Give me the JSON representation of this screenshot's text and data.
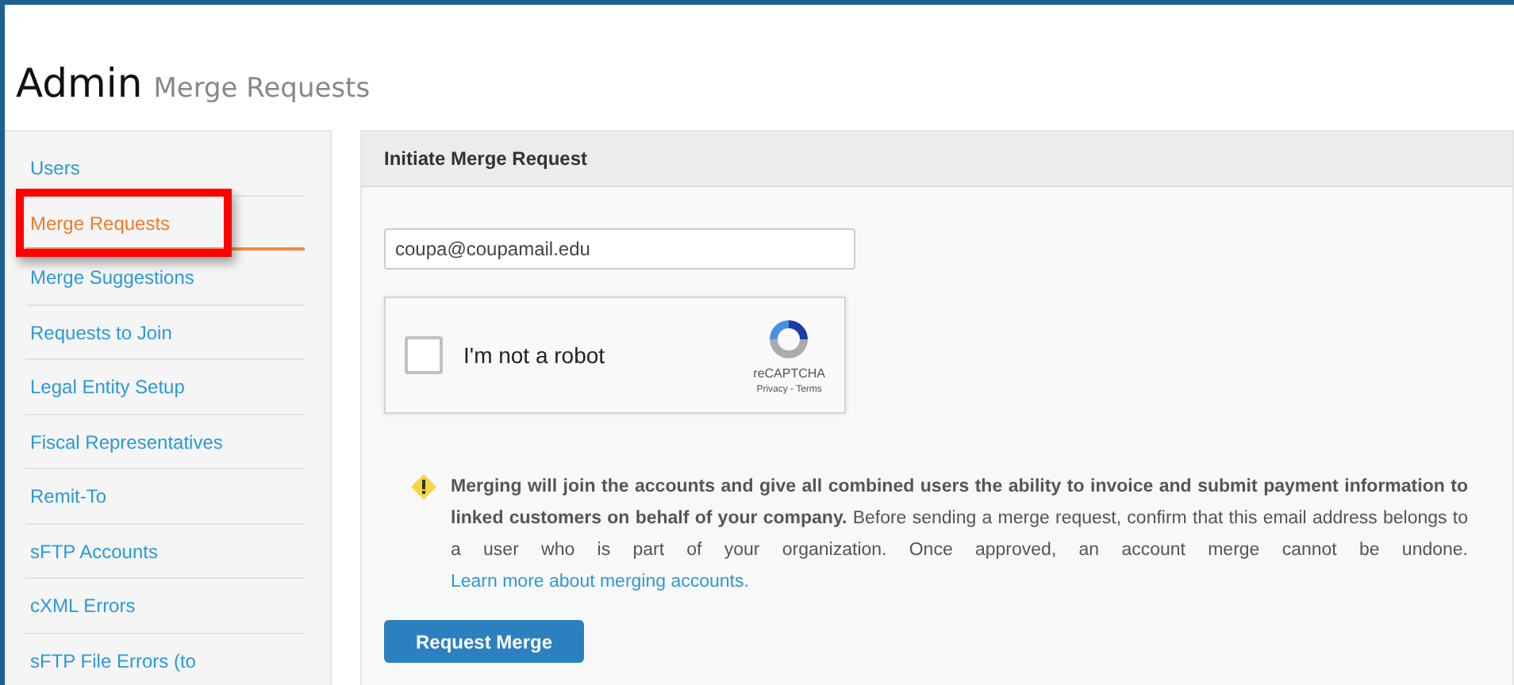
{
  "header": {
    "title": "Admin",
    "subtitle": "Merge Requests"
  },
  "sidebar": {
    "items": [
      {
        "label": "Users",
        "selected": false,
        "highlighted": false
      },
      {
        "label": "Merge Requests",
        "selected": true,
        "highlighted": true
      },
      {
        "label": "Merge Suggestions",
        "selected": false,
        "highlighted": false
      },
      {
        "label": "Requests to Join",
        "selected": false,
        "highlighted": false
      },
      {
        "label": "Legal Entity Setup",
        "selected": false,
        "highlighted": false
      },
      {
        "label": "Fiscal Representatives",
        "selected": false,
        "highlighted": false
      },
      {
        "label": "Remit-To",
        "selected": false,
        "highlighted": false
      },
      {
        "label": "sFTP Accounts",
        "selected": false,
        "highlighted": false
      },
      {
        "label": "cXML Errors",
        "selected": false,
        "highlighted": false
      },
      {
        "label": "sFTP File Errors (to",
        "selected": false,
        "highlighted": false
      }
    ]
  },
  "panel": {
    "title": "Initiate Merge Request",
    "email": {
      "value": "coupa@coupamail.edu"
    },
    "captcha": {
      "label": "I'm not a robot",
      "checked": false,
      "brand": "reCAPTCHA",
      "links": "Privacy - Terms"
    },
    "notice": {
      "text": "**Merging will join the accounts and give all combined users the ability to invoice and submit payment information to linked customers on behalf of your company.** Before sending a merge request, confirm that this email address belongs to a user who is part of your organization. Once approved, an account merge cannot be undone.",
      "link": "Learn more about merging accounts."
    },
    "button": "Request Merge"
  }
}
